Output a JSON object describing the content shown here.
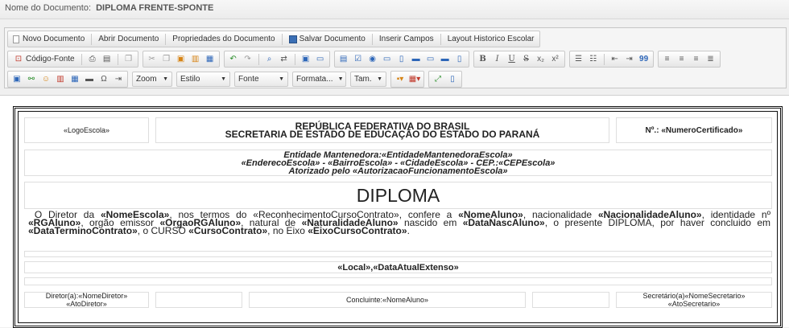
{
  "header": {
    "label": "Nome do Documento:",
    "document_name": "DIPLOMA FRENTE-SPONTE"
  },
  "toolbar_row1": {
    "novo": "Novo Documento",
    "abrir": "Abrir Documento",
    "propriedades": "Propriedades do Documento",
    "salvar": "Salvar Documento",
    "inserir": "Inserir Campos",
    "layout": "Layout Historico Escolar"
  },
  "toolbar_row2": {
    "codigo_fonte": "Código-Fonte",
    "bold": "B",
    "italic": "I",
    "underline": "U",
    "strike": "S",
    "subscript": "x₂",
    "superscript": "x²",
    "quote": "99"
  },
  "toolbar_row3": {
    "zoom": "Zoom",
    "estilo": "Estilo",
    "fonte": "Fonte",
    "formatacao": "Formata...",
    "tamanho": "Tam."
  },
  "diploma": {
    "logo": "«LogoEscola»",
    "republica": "REPÚBLICA FEDERATIVA DO BRASIL",
    "secretaria": "SECRETARIA DE ESTADO DE EDUCAÇÃO DO ESTADO DO PARANÁ",
    "numero_label": "Nº.:",
    "numero_value": "«NumeroCertificado»",
    "mantenedora": "Entidade Mantenedora:«EntidadeMantenedoraEscola»",
    "endereco": "«EnderecoEscola» - «BairroEscola» - «CidadeEscola» - CEP.:«CEPEscola»",
    "autorizado": "Atorizado pelo «AutorizacaoFuncionamentoEscola»",
    "title": "DIPLOMA",
    "body": {
      "t1": "O Diretor da ",
      "nome_escola": "«NomeEscola»",
      "t2": ", nos termos do «ReconhecimentoCursoContrato», confere a ",
      "nome_aluno": "«NomeAluno»",
      "t3": ", nacionalidade ",
      "nacionalidade": "«NacionalidadeAluno»",
      "t4": ", identidade nº ",
      "rg": "«RGAluno»",
      "t5": ", orgão emissor ",
      "orgao": "«OrgaoRGAluno»",
      "t6": ", natural de ",
      "naturalidade": "«NaturalidadeAluno»",
      "t7": " nascido em ",
      "data_nasc": "«DataNascAluno»",
      "t8": ", o presente DIPLOMA, por haver concluido em ",
      "data_termino": "«DataTerminoContrato»",
      "t9": ", o CURSO ",
      "curso": "«CursoContrato»",
      "t10": ", no Eixo ",
      "eixo": "«EixoCursoContrato»",
      "t11": "."
    },
    "local_data": "«Local»,«DataAtualExtenso»",
    "diretor": "Diretor(a):«NomeDiretor»",
    "ato_diretor": "«AtoDiretor»",
    "concluinte": "Concluinte:«NomeAluno»",
    "secretario": "Secretário(a)«NomeSecretario»",
    "ato_secretario": "«AtoSecretario»"
  }
}
